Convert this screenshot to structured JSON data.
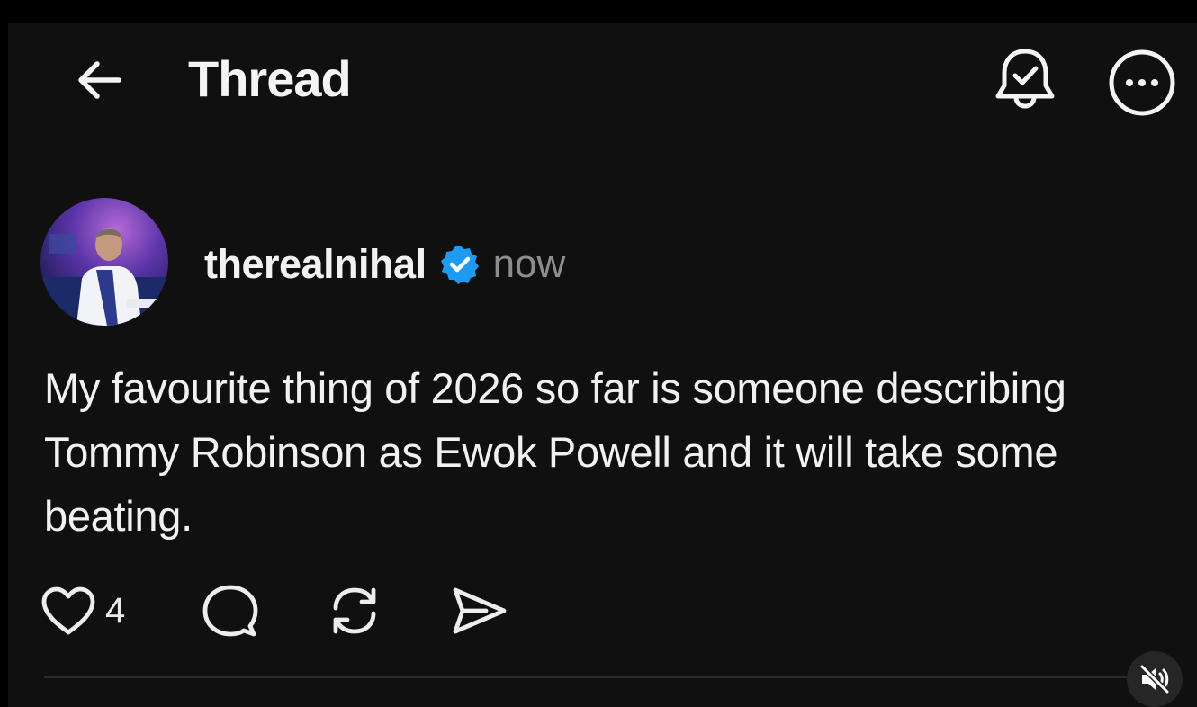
{
  "header": {
    "title": "Thread",
    "back_icon": "arrow-left-icon",
    "notify_icon": "bell-check-icon",
    "more_icon": "more-horizontal-icon"
  },
  "post": {
    "username": "therealnihal",
    "verified": true,
    "timestamp": "now",
    "text": "My favourite thing of 2026 so far is someone describing Tommy Robinson as Ewok Powell and it will take some beating.",
    "likes": "4"
  },
  "actions": {
    "like_icon": "heart-icon",
    "reply_icon": "comment-icon",
    "repost_icon": "repost-icon",
    "share_icon": "send-icon"
  },
  "video_overlay": {
    "mute_icon": "volume-muted-icon"
  },
  "colors": {
    "background": "#101010",
    "text_primary": "#f3f3f3",
    "text_secondary": "#8d8d8d",
    "verified_blue": "#1d9bf0"
  }
}
